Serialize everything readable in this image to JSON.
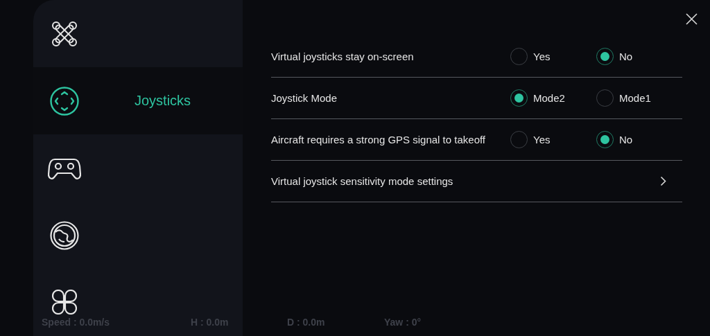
{
  "sidebar": {
    "items": [
      {
        "selected": false
      },
      {
        "selected": true,
        "label": "Joysticks"
      },
      {
        "selected": false
      },
      {
        "selected": false
      },
      {
        "selected": false
      }
    ]
  },
  "settings": [
    {
      "kind": "radio",
      "label": "Virtual joysticks stay on-screen",
      "options": [
        {
          "label": "Yes",
          "selected": false
        },
        {
          "label": "No",
          "selected": true
        }
      ]
    },
    {
      "kind": "radio",
      "label": "Joystick Mode",
      "options": [
        {
          "label": "Mode2",
          "selected": true
        },
        {
          "label": "Mode1",
          "selected": false
        }
      ]
    },
    {
      "kind": "radio",
      "label": "Aircraft requires a strong GPS signal to takeoff",
      "options": [
        {
          "label": "Yes",
          "selected": false
        },
        {
          "label": "No",
          "selected": true
        }
      ]
    },
    {
      "kind": "link",
      "label": "Virtual joystick sensitivity mode settings"
    }
  ],
  "telemetry": [
    "Speed : 0.0m/s",
    "H : 0.0m",
    "D : 0.0m",
    "Yaw : 0°"
  ]
}
